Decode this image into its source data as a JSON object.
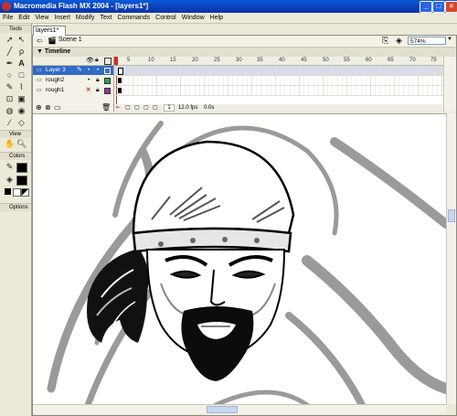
{
  "window": {
    "title": "Macromedia Flash MX 2004 - [layers1*]"
  },
  "menu": [
    "File",
    "Edit",
    "View",
    "Insert",
    "Modify",
    "Text",
    "Commands",
    "Control",
    "Window",
    "Help"
  ],
  "tools_panel": {
    "title": "Tools",
    "view_title": "View",
    "colors_title": "Colors",
    "options_title": "Options",
    "tools": [
      "arrow-icon",
      "subselect-icon",
      "line-icon",
      "lasso-icon",
      "pen-icon",
      "text-icon",
      "oval-icon",
      "rectangle-icon",
      "pencil-icon",
      "brush-icon",
      "free-transform-icon",
      "fill-transform-icon",
      "ink-bottle-icon",
      "paint-bucket-icon",
      "eyedropper-icon",
      "eraser-icon"
    ]
  },
  "document": {
    "tab": "layers1*",
    "scene": "Scene 1",
    "zoom": "574%"
  },
  "timeline": {
    "title": "Timeline",
    "ruler": [
      "5",
      "10",
      "15",
      "20",
      "25",
      "30",
      "35",
      "40",
      "45",
      "50",
      "55",
      "60",
      "65",
      "70",
      "75",
      "80",
      "85",
      "90",
      "95"
    ],
    "layers": [
      {
        "name": "Layer 3",
        "selected": true,
        "color": "#4a6ad0"
      },
      {
        "name": "rough2",
        "selected": false,
        "color": "#30a050"
      },
      {
        "name": "rough1",
        "selected": false,
        "color": "#a030a0"
      }
    ],
    "current_frame": "1",
    "fps": "12.0 fps",
    "time": "0.0s"
  },
  "colors": {
    "accent": "#0a4fd0",
    "selection": "#316ac5",
    "playhead": "#d03020"
  }
}
